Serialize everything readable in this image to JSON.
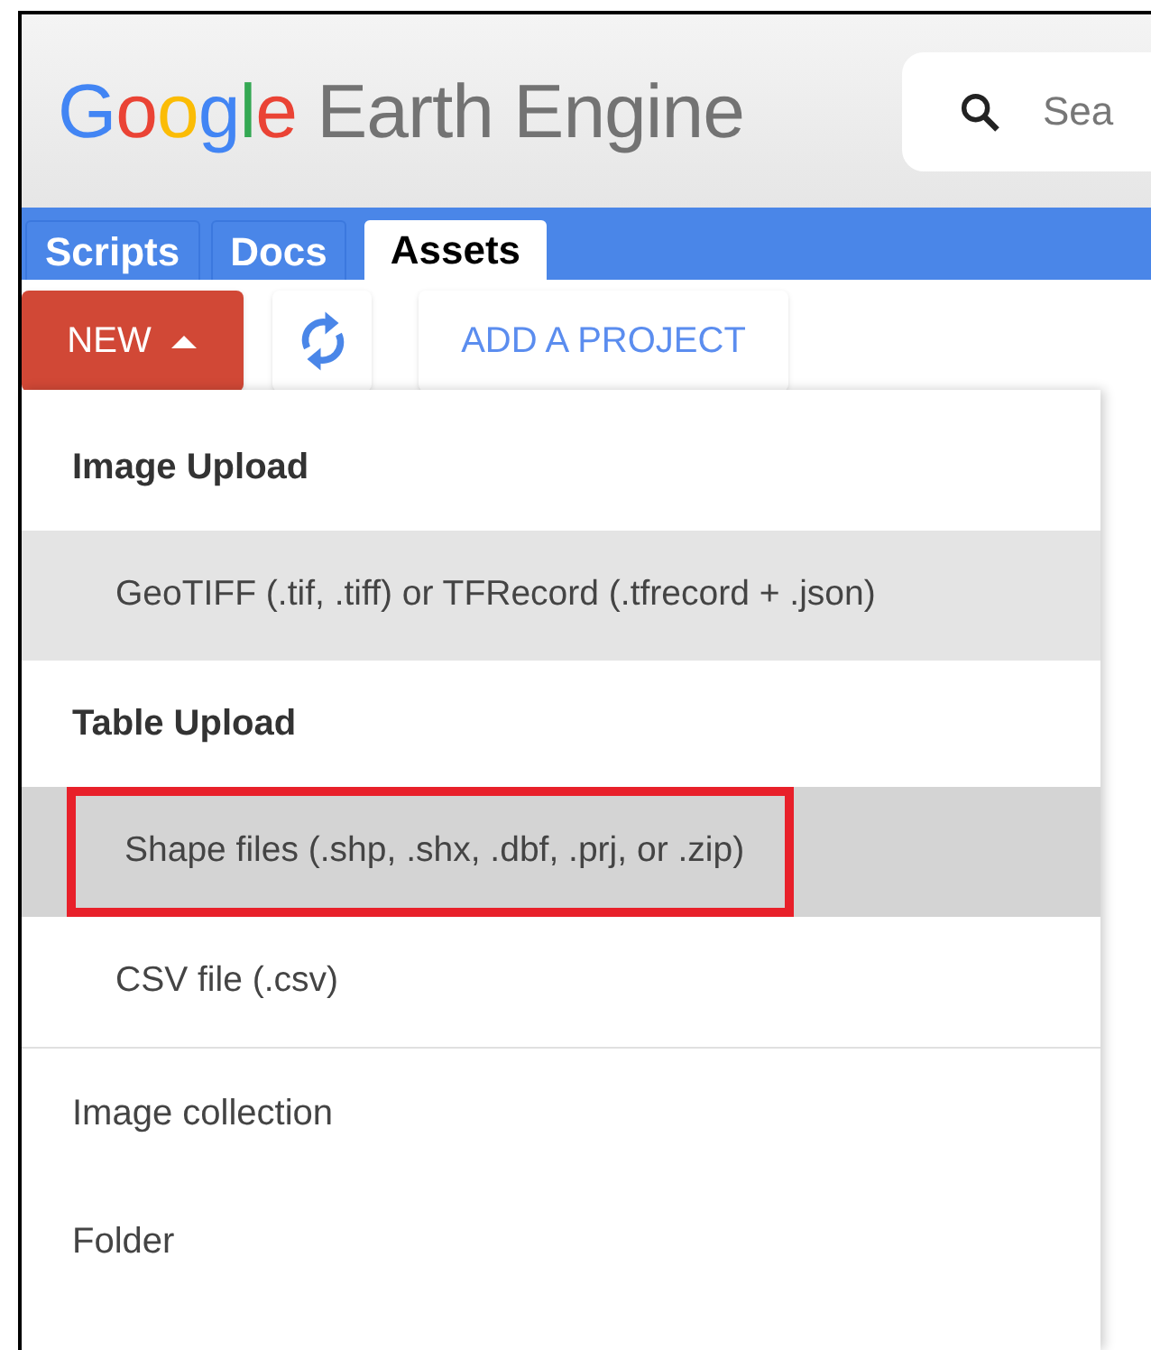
{
  "header": {
    "logo_brand": "Google",
    "logo_product": "Earth Engine",
    "search": {
      "placeholder": "Sea"
    }
  },
  "tabs": [
    {
      "label": "Scripts",
      "selected": false
    },
    {
      "label": "Docs",
      "selected": false
    },
    {
      "label": "Assets",
      "selected": true
    }
  ],
  "toolbar": {
    "new_button": {
      "label": "NEW",
      "expanded": true
    },
    "add_project_button": {
      "label": "ADD A PROJECT"
    }
  },
  "menu": {
    "sections": [
      {
        "items": [
          {
            "kind": "header",
            "label": "Image Upload"
          },
          {
            "kind": "option",
            "label": "GeoTIFF (.tif, .tiff) or TFRecord (.tfrecord + .json)",
            "hovered": true,
            "selected": false,
            "annotated": false
          },
          {
            "kind": "header",
            "label": "Table Upload"
          },
          {
            "kind": "option",
            "label": "Shape files (.shp, .shx, .dbf, .prj, or .zip)",
            "hovered": false,
            "selected": true,
            "annotated": true
          },
          {
            "kind": "option",
            "label": "CSV file (.csv)",
            "hovered": false,
            "selected": false,
            "annotated": false
          }
        ]
      },
      {
        "items": [
          {
            "kind": "item",
            "label": "Image collection"
          },
          {
            "kind": "item",
            "label": "Folder"
          }
        ]
      }
    ]
  }
}
